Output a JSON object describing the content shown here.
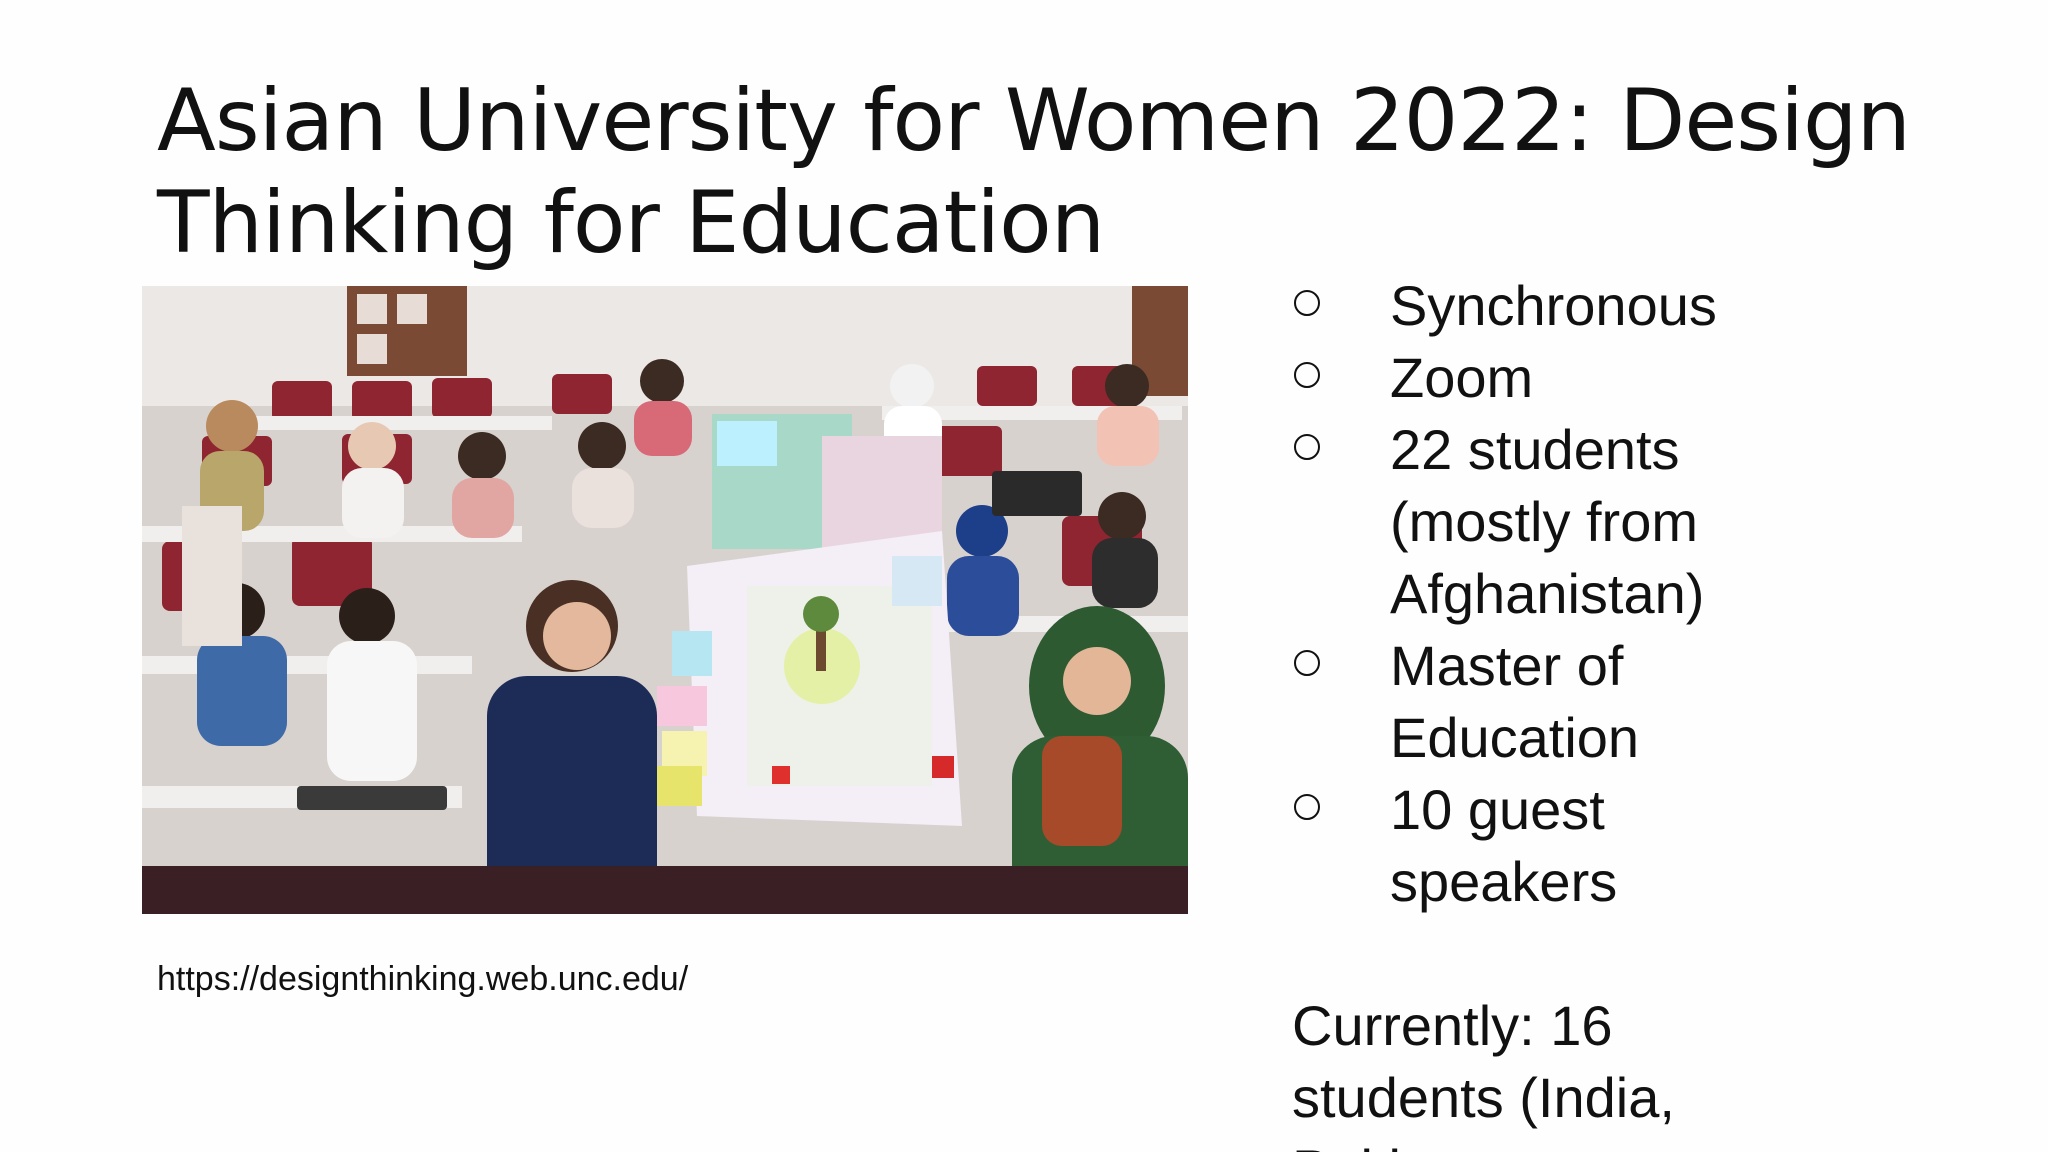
{
  "slide": {
    "title_lines": [
      "Asian University for Women 2022: Design",
      "Thinking for Education"
    ],
    "photo_icon": "classroom-photo",
    "caption_url": "https://designthinking.web.unc.edu/",
    "bullets": [
      {
        "lines": [
          "Synchronous"
        ]
      },
      {
        "lines": [
          "Zoom"
        ]
      },
      {
        "lines": [
          "22 students",
          "(mostly from",
          "Afghanistan)"
        ]
      },
      {
        "lines": [
          "Master of",
          "Education"
        ]
      },
      {
        "lines": [
          "10 guest",
          "speakers"
        ]
      }
    ],
    "currently_lines": [
      "Currently: 16",
      "students (India,",
      "Pakistan,"
    ],
    "colors": {
      "text": "#111111",
      "background": "#fefefe"
    }
  }
}
